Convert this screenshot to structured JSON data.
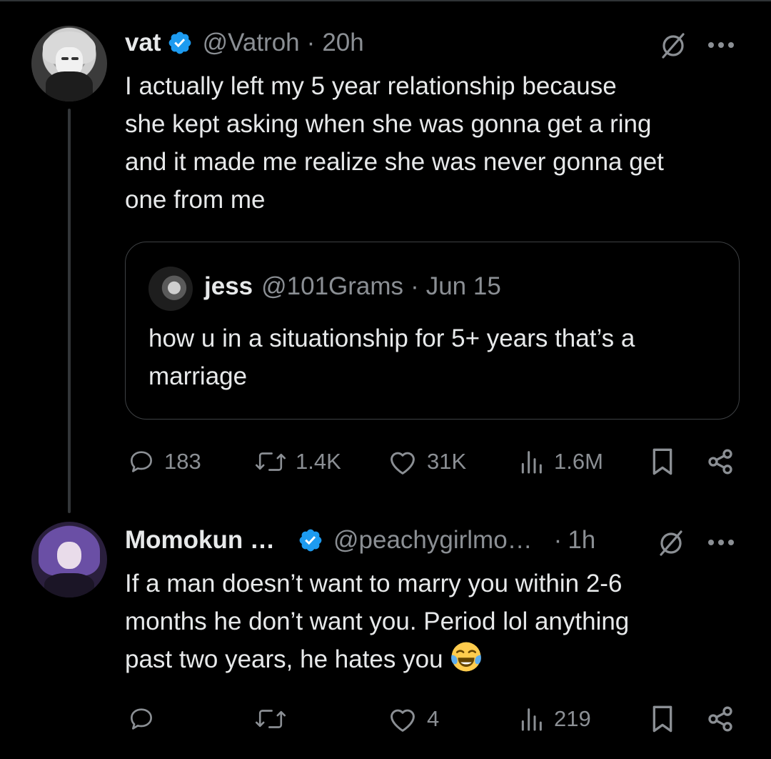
{
  "tweets": [
    {
      "name": "vat",
      "handle": "@Vatroh",
      "sep": "·",
      "time": "20h",
      "text_lines": [
        "I actually left my 5 year relationship because",
        "she kept asking when she was gonna get a ring",
        "and it made me realize she was never gonna get",
        "one from me"
      ],
      "quote": {
        "name": "jess",
        "handle": "@101Grams",
        "sep": "·",
        "date": "Jun 15",
        "text_lines": [
          "how u in a situationship for 5+ years that’s a",
          "marriage"
        ]
      },
      "stats": {
        "replies": "183",
        "reposts": "1.4K",
        "likes": "31K",
        "views": "1.6M"
      }
    },
    {
      "name": "Momokun …",
      "handle": "@peachygirlmo…",
      "sep": "·",
      "time": "1h",
      "text_lines": [
        "If a man doesn’t want to marry you within 2-6",
        "months he don’t want you. Period lol anything",
        "past two years, he hates you"
      ],
      "stats": {
        "likes": "4",
        "views": "219"
      }
    }
  ],
  "icons": {
    "verified": "verified-badge-icon",
    "grok": "slash-circle-icon",
    "more": "more-dots-icon",
    "reply": "reply-bubble-icon",
    "repost": "repost-icon",
    "like": "heart-icon",
    "views": "bar-chart-icon",
    "bookmark": "bookmark-icon",
    "share": "share-icon",
    "emoji": "face-with-tears-of-joy"
  },
  "colors": {
    "background": "#000000",
    "text": "#e7e9ea",
    "secondary": "#8b8f94",
    "verified": "#1d9bf0"
  }
}
